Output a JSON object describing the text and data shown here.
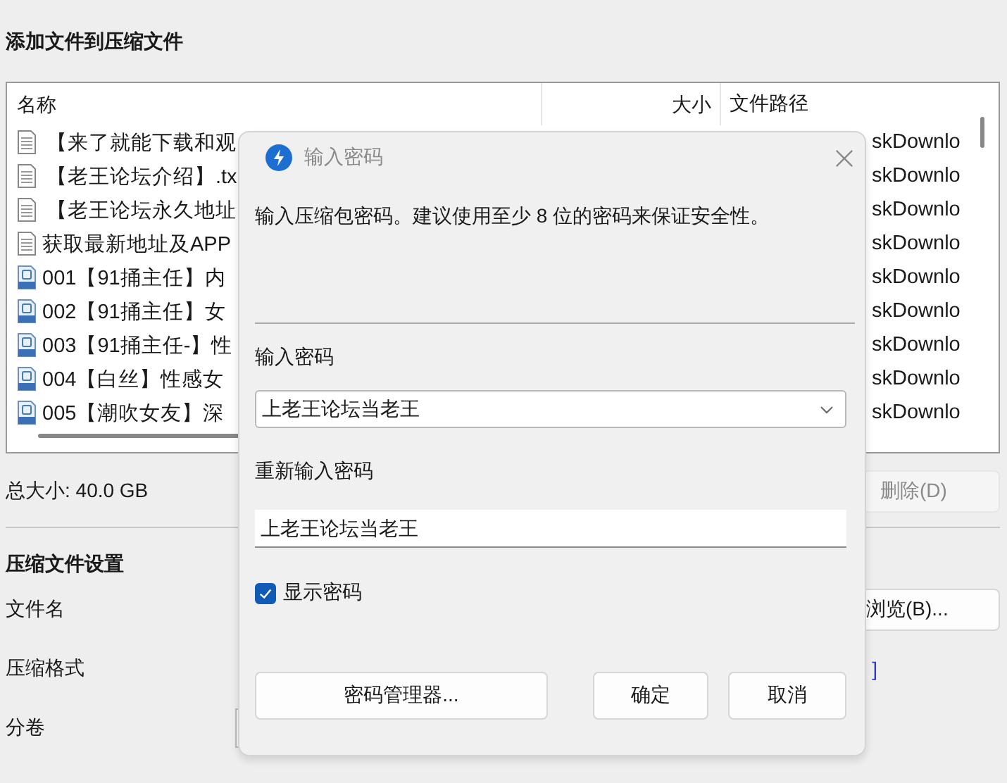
{
  "window": {
    "title": "添加文件到压缩文件"
  },
  "file_list": {
    "columns": [
      "名称",
      "大小",
      "文件路径"
    ],
    "rows": [
      {
        "kind": "text",
        "name": "【来了就能下载和观",
        "path": "skDownlo"
      },
      {
        "kind": "text",
        "name": "【老王论坛介绍】.tx",
        "path": "skDownlo"
      },
      {
        "kind": "text",
        "name": "【老王论坛永久地址",
        "path": "skDownlo"
      },
      {
        "kind": "text",
        "name": "获取最新地址及APP",
        "path": "skDownlo"
      },
      {
        "kind": "video",
        "name": "001【91捅主任】内",
        "path": "skDownlo"
      },
      {
        "kind": "video",
        "name": "002【91捅主任】女",
        "path": "skDownlo"
      },
      {
        "kind": "video",
        "name": "003【91捅主任-】性",
        "path": "skDownlo"
      },
      {
        "kind": "video",
        "name": "004【白丝】性感女",
        "path": "skDownlo"
      },
      {
        "kind": "video",
        "name": "005【潮吹女友】深",
        "path": "skDownlo"
      }
    ]
  },
  "total_size": "总大小: 40.0 GB",
  "delete_button": {
    "label": "删除(D)",
    "disabled": true
  },
  "settings": {
    "title": "压缩文件设置",
    "filename_label": "文件名",
    "browse_button": "浏览(B)...",
    "format_label": "压缩格式",
    "format_fragment": "]",
    "volume_label": "分卷"
  },
  "dialog": {
    "title": "输入密码",
    "message": "输入压缩包密码。建议使用至少 8 位的密码来保证安全性。",
    "password_label": "输入密码",
    "password_value": "上老王论坛当老王",
    "confirm_label": "重新输入密码",
    "confirm_value": "上老王论坛当老王",
    "show_password": {
      "label": "显示密码",
      "checked": true
    },
    "buttons": [
      "密码管理器...",
      "确定",
      "取消"
    ]
  }
}
